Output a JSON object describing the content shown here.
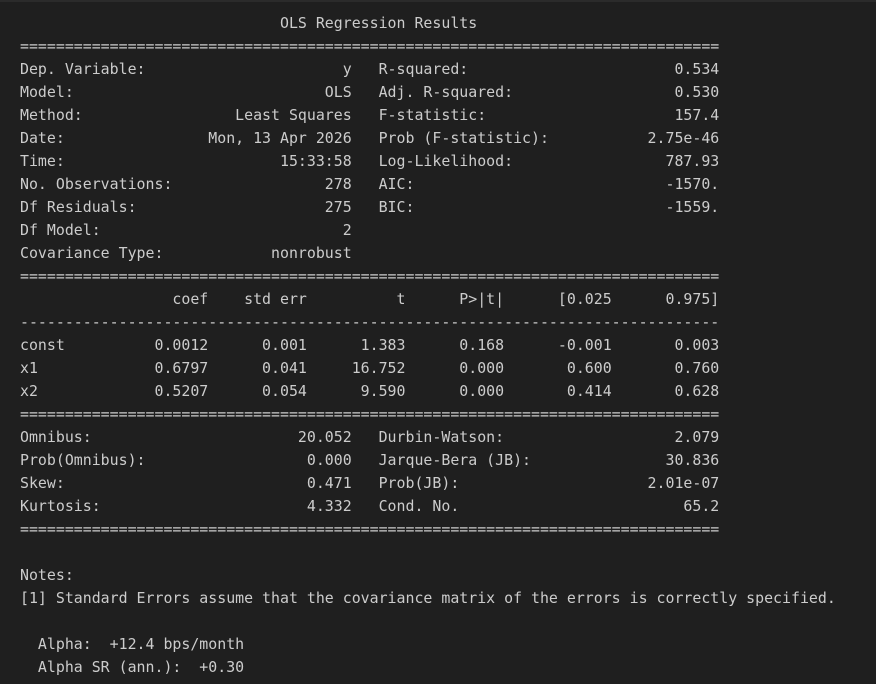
{
  "output": {
    "lines": [
      "                             OLS Regression Results                            ",
      "==============================================================================",
      "Dep. Variable:                      y   R-squared:                       0.534",
      "Model:                            OLS   Adj. R-squared:                  0.530",
      "Method:                 Least Squares   F-statistic:                     157.4",
      "Date:                Mon, 13 Apr 2026   Prob (F-statistic):           2.75e-46",
      "Time:                        15:33:58   Log-Likelihood:                 787.93",
      "No. Observations:                 278   AIC:                            -1570.",
      "Df Residuals:                     275   BIC:                            -1559.",
      "Df Model:                           2                                         ",
      "Covariance Type:            nonrobust                                         ",
      "==============================================================================",
      "                 coef    std err          t      P>|t|      [0.025      0.975]",
      "------------------------------------------------------------------------------",
      "const          0.0012      0.001      1.383      0.168      -0.001       0.003",
      "x1             0.6797      0.041     16.752      0.000       0.600       0.760",
      "x2             0.5207      0.054      9.590      0.000       0.414       0.628",
      "==============================================================================",
      "Omnibus:                       20.052   Durbin-Watson:                   2.079",
      "Prob(Omnibus):                  0.000   Jarque-Bera (JB):               30.836",
      "Skew:                           0.471   Prob(JB):                     2.01e-07",
      "Kurtosis:                       4.332   Cond. No.                         65.2",
      "==============================================================================",
      "",
      "Notes:",
      "[1] Standard Errors assume that the covariance matrix of the errors is correctly specified.",
      "",
      "  Alpha:  +12.4 bps/month",
      "  Alpha SR (ann.):  +0.30"
    ]
  }
}
